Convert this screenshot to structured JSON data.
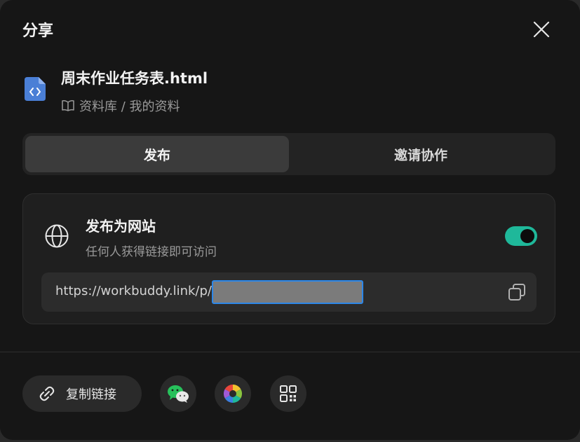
{
  "dialog": {
    "title": "分享"
  },
  "file": {
    "name": "周末作业任务表.html",
    "path": "资料库 / 我的资料"
  },
  "tabs": [
    {
      "label": "发布",
      "active": true
    },
    {
      "label": "邀请协作",
      "active": false
    }
  ],
  "publish": {
    "title": "发布为网站",
    "description": "任何人获得链接即可访问",
    "enabled": true,
    "url_prefix": "https://workbuddy.link/p/"
  },
  "footer": {
    "copy_link_label": "复制链接"
  },
  "colors": {
    "accent": "#1fb89a",
    "file_icon": "#4a7fd6",
    "selection": "#2d87e8",
    "wechat": "#27c15b"
  }
}
